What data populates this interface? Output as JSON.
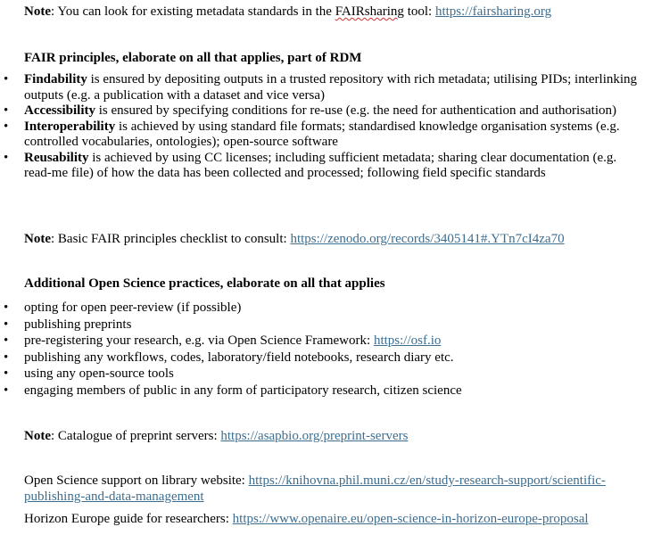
{
  "note1": {
    "label": "Note",
    "text_before": ": You can look for existing metadata standards in the ",
    "tool_name": "FAIRsharing",
    "text_after": " tool: ",
    "link": "https://fairsharing.org"
  },
  "fair": {
    "heading": "FAIR principles, elaborate on all that applies, part of RDM",
    "items": [
      {
        "term": "Findability",
        "text": " is ensured by depositing outputs in a trusted repository with rich metadata; utilising PIDs; interlinking outputs (e.g. a publication with a dataset and vice versa)"
      },
      {
        "term": "Accessibility",
        "text": " is ensured by specifying conditions for re-use (e.g. the need for authentication and authorisation)"
      },
      {
        "term": "Interoperability",
        "text": " is achieved by using standard file formats; standardised knowledge organisation systems (e.g. controlled vocabularies, ontologies); open-source software"
      },
      {
        "term": "Reusability",
        "text": " is achieved by using CC licenses; including sufficient metadata; sharing clear documentation (e.g. read-me file) of how the data has been collected and processed; following field specific standards"
      }
    ]
  },
  "note2": {
    "label": "Note",
    "text": ": Basic FAIR principles checklist to consult: ",
    "link": "https://zenodo.org/records/3405141#.YTn7cI4za70"
  },
  "open_science": {
    "heading": "Additional Open Science practices, elaborate on all that applies",
    "items": [
      {
        "text": "opting for open peer-review (if possible)",
        "link": ""
      },
      {
        "text": "publishing preprints",
        "link": ""
      },
      {
        "text": "pre-registering your research, e.g. via Open Science Framework: ",
        "link": "https://osf.io"
      },
      {
        "text": "publishing any workflows, codes, laboratory/field notebooks, research diary etc.",
        "link": ""
      },
      {
        "text": "using any open-source tools",
        "link": ""
      },
      {
        "text": "engaging members of public in any form of participatory research, citizen science",
        "link": ""
      }
    ]
  },
  "note3": {
    "label": "Note",
    "text": ": Catalogue of preprint servers: ",
    "link": "https://asapbio.org/preprint-servers"
  },
  "library": {
    "text": "Open Science support on library website: ",
    "link": "https://knihovna.phil.muni.cz/en/study-research-support/scientific-publishing-and-data-management"
  },
  "horizon": {
    "text": "Horizon Europe guide for researchers: ",
    "link": "https://www.openaire.eu/open-science-in-horizon-europe-proposal"
  }
}
